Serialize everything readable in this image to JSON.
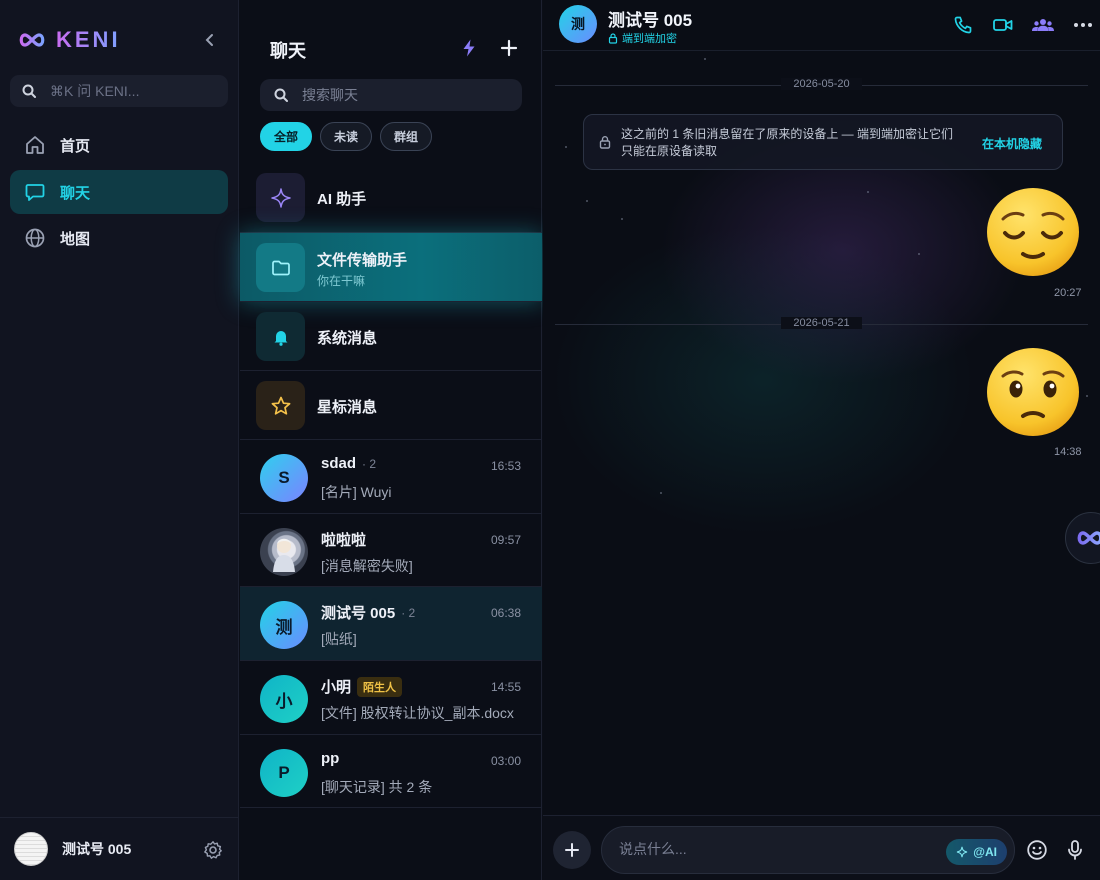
{
  "app": {
    "brand": "KENI",
    "colors": {
      "accent": "#22d3e6",
      "brand_gradient": [
        "#c96cf0",
        "#7da2ff"
      ]
    }
  },
  "nav": {
    "search_placeholder": "⌘K 问 KENI...",
    "items": [
      {
        "label": "首页",
        "icon": "home-icon"
      },
      {
        "label": "聊天",
        "icon": "chat-icon",
        "active": true
      },
      {
        "label": "地图",
        "icon": "globe-icon"
      }
    ],
    "user": {
      "name": "测试号 005"
    }
  },
  "chatlist": {
    "title": "聊天",
    "search_placeholder": "搜索聊天",
    "filters": [
      "全部",
      "未读",
      "群组"
    ],
    "pinned": [
      {
        "name": "AI 助手",
        "icon": "sparkle-icon"
      },
      {
        "name": "文件传输助手",
        "subtitle": "你在干嘛",
        "icon": "folder-icon"
      },
      {
        "name": "系统消息",
        "icon": "bell-icon"
      },
      {
        "name": "星标消息",
        "icon": "star-icon"
      }
    ],
    "chats": [
      {
        "name": "sdad",
        "count": "· 2",
        "time": "16:53",
        "preview": "[名片] Wuyi",
        "avatar_text": "S"
      },
      {
        "name": "啦啦啦",
        "count": "",
        "time": "09:57",
        "preview": "[消息解密失败]",
        "avatar_text": ""
      },
      {
        "name": "测试号 005",
        "count": "· 2",
        "time": "06:38",
        "preview": "[贴纸]",
        "avatar_text": "测"
      },
      {
        "name": "小明",
        "badge": "陌生人",
        "time": "14:55",
        "preview": "[文件] 股权转让协议_副本.docx",
        "avatar_text": "小"
      },
      {
        "name": "pp",
        "count": "",
        "time": "03:00",
        "preview": "[聊天记录] 共 2 条",
        "avatar_text": "P"
      }
    ]
  },
  "conversation": {
    "name": "测试号 005",
    "avatar_text": "测",
    "subtitle": "端到端加密",
    "notice": {
      "text": "这之前的 1 条旧消息留在了原来的设备上 — 端到端加密让它们只能在原设备读取",
      "action": "在本机隐藏"
    },
    "messages": [
      {
        "date": "2026-05-20",
        "emoji": "relieved-face",
        "time": "20:27"
      },
      {
        "date": "2026-05-21",
        "emoji": "face-with-tear",
        "time": "14:38"
      }
    ],
    "composer": {
      "placeholder": "说点什么...",
      "ai_label": "@AI"
    }
  }
}
